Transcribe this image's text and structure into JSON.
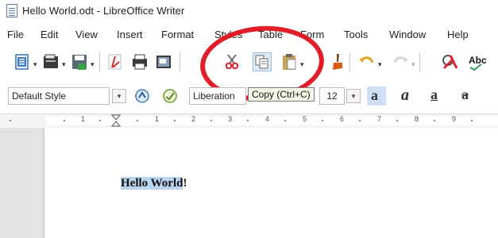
{
  "window": {
    "title": "Hello World.odt - LibreOffice Writer"
  },
  "menubar": {
    "items": [
      "File",
      "Edit",
      "View",
      "Insert",
      "Format",
      "Styles",
      "Table",
      "Form",
      "Tools",
      "Window",
      "Help"
    ]
  },
  "toolbar_standard": {
    "buttons": [
      "new-document",
      "open",
      "save",
      "export-pdf",
      "print",
      "print-preview",
      "cut",
      "copy",
      "paste",
      "clone-formatting",
      "undo",
      "redo",
      "find-replace",
      "spelling"
    ],
    "highlight_color": "#e21d2a"
  },
  "toolbar_formatting": {
    "paragraph_style": "Default Style",
    "font_name": "Liberation",
    "font_size": "12",
    "bold_label": "a",
    "italic_label": "a",
    "underline_label": "a",
    "strike_label": "a"
  },
  "tooltip": {
    "text": "Copy (Ctrl+C)"
  },
  "ruler": {
    "labels": [
      "1",
      "1",
      "2",
      "3",
      "4",
      "5",
      "6",
      "7",
      "8",
      "9"
    ]
  },
  "document": {
    "selected_text": "Hello World",
    "trailing_text": "!"
  },
  "colors": {
    "selection": "#b8d4f0",
    "gutter": "#e3e3e3",
    "accent_ring": "#e21d2a"
  }
}
